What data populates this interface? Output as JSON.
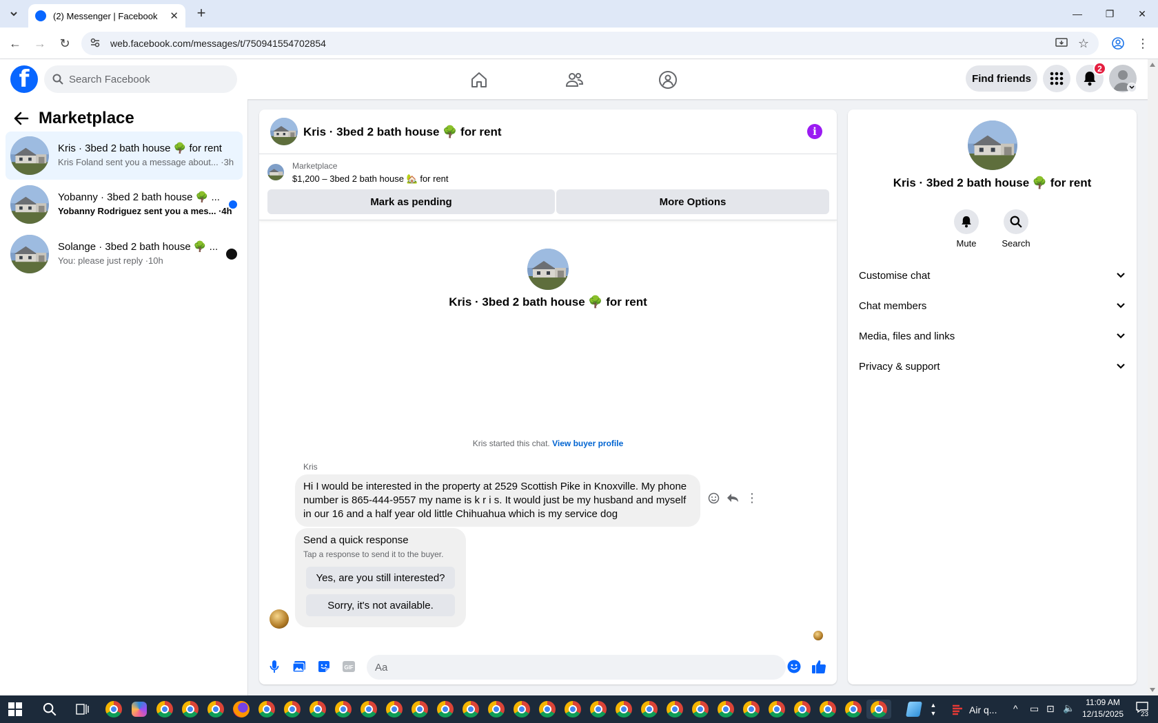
{
  "browser": {
    "tab_title": "(2) Messenger | Facebook",
    "url": "web.facebook.com/messages/t/750941554702854"
  },
  "header": {
    "search_placeholder": "Search Facebook",
    "find_friends": "Find friends",
    "notification_count": "2"
  },
  "sidebar": {
    "title": "Marketplace",
    "conversations": [
      {
        "name": "Kris · 3bed 2 bath house 🌳 for rent",
        "snippet": "Kris Foland sent you a message about... ·3h",
        "unread": false
      },
      {
        "name": "Yobanny · 3bed 2 bath house 🌳 ...",
        "snippet": "Yobanny Rodriguez sent you a mes... ·4h",
        "unread": true
      },
      {
        "name": "Solange · 3bed 2 bath house 🌳 ...",
        "snippet": "You: please just reply ·10h",
        "unread": false
      }
    ]
  },
  "chat": {
    "title": "Kris · 3bed 2 bath house 🌳 for rent",
    "marketplace_label": "Marketplace",
    "listing": "$1,200 – 3bed 2 bath house 🏡 for rent",
    "mark_pending": "Mark as pending",
    "more_options": "More Options",
    "intro_title": "Kris · 3bed 2 bath house 🌳 for rent",
    "started_text": "Kris started this chat.",
    "view_buyer": "View buyer profile",
    "sender": "Kris",
    "message": "Hi I would be interested in the property at 2529 Scottish Pike in Knoxville. My phone number is 865-444-9557 my name is k r i s. It would just be my husband and myself in our 16 and a half year old little Chihuahua which is my service dog",
    "quick_title": "Send a quick response",
    "quick_sub": "Tap a response to send it to the buyer.",
    "quick_options": [
      "Yes, are you still interested?",
      "Sorry, it's not available."
    ],
    "composer_placeholder": "Aa"
  },
  "details": {
    "title": "Kris · 3bed 2 bath house 🌳 for rent",
    "mute": "Mute",
    "search": "Search",
    "sections": [
      "Customise chat",
      "Chat members",
      "Media, files and links",
      "Privacy & support"
    ]
  },
  "taskbar": {
    "weather": "Air q...",
    "time": "11:09 AM",
    "date": "12/15/2025",
    "notif_count": "23"
  },
  "colors": {
    "facebook_blue": "#0866ff",
    "messenger_purple": "#9b1bf2",
    "link_blue": "#0064d1",
    "unread_dot": "#0866ff"
  }
}
